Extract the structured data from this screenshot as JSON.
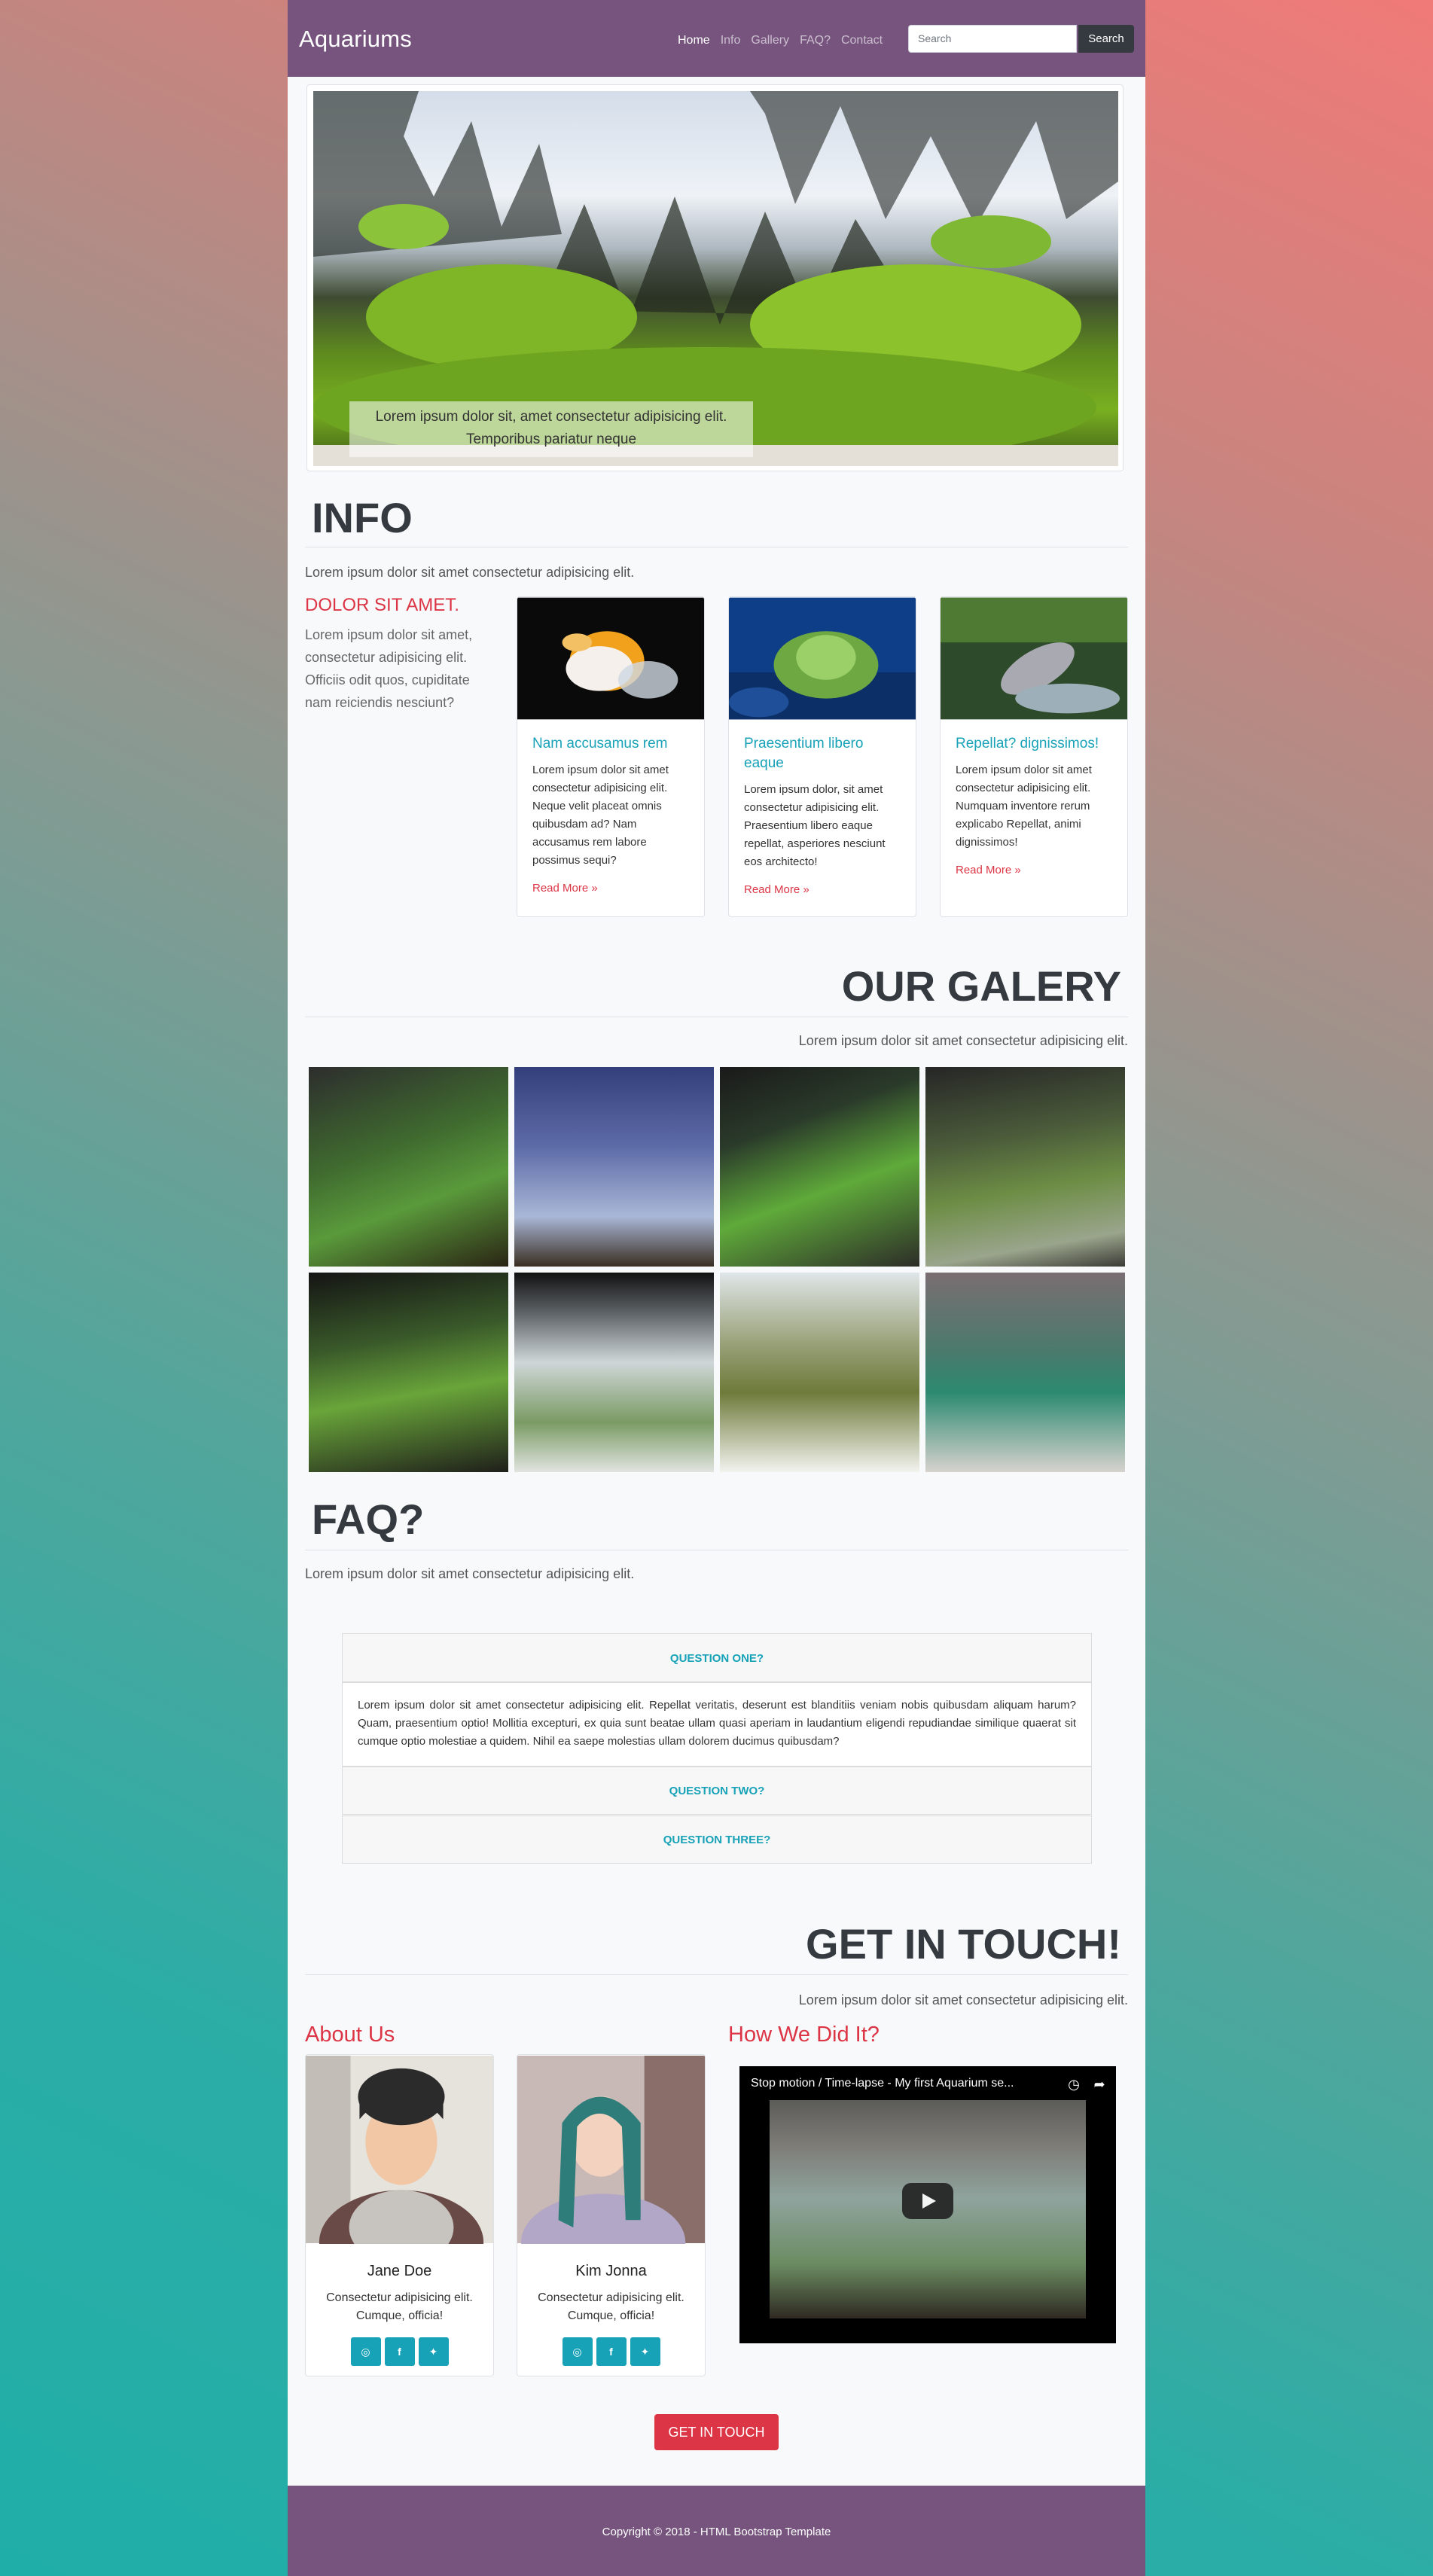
{
  "navbar": {
    "brand": "Aquariums",
    "links": [
      "Home",
      "Info",
      "Gallery",
      "FAQ?",
      "Contact"
    ],
    "search_placeholder": "Search",
    "search_button": "Search"
  },
  "hero": {
    "caption_line1": "Lorem ipsum dolor sit, amet consectetur adipisicing elit.",
    "caption_line2": "Temporibus pariatur neque"
  },
  "info": {
    "title": "INFO",
    "lead": "Lorem ipsum dolor sit amet consectetur adipisicing elit.",
    "side_heading": "DOLOR SIT AMET.",
    "side_text": "Lorem ipsum dolor sit amet, consectetur adipisicing elit. Officiis odit quos, cupiditate nam reiciendis nesciunt?",
    "cards": [
      {
        "title": "Nam accusamus rem",
        "text": "Lorem ipsum dolor sit amet consectetur adipisicing elit. Neque velit placeat omnis quibusdam ad? Nam accusamus rem labore possimus sequi?",
        "link": "Read More »"
      },
      {
        "title": "Praesentium libero eaque",
        "text": "Lorem ipsum dolor, sit amet consectetur adipisicing elit. Praesentium libero eaque repellat, asperiores nesciunt eos architecto!",
        "link": "Read More »"
      },
      {
        "title": "Repellat? dignissimos!",
        "text": "Lorem ipsum dolor sit amet consectetur adipisicing elit. Numquam inventore rerum explicabo Repellat, animi dignissimos!",
        "link": "Read More »"
      }
    ]
  },
  "gallery": {
    "title": "OUR GALERY",
    "lead": "Lorem ipsum dolor sit amet consectetur adipisicing elit."
  },
  "faq": {
    "title": "FAQ?",
    "lead": "Lorem ipsum dolor sit amet consectetur adipisicing elit.",
    "q1": "QUESTION ONE?",
    "a1": "Lorem ipsum dolor sit amet consectetur adipisicing elit. Repellat veritatis, deserunt est blanditiis veniam nobis quibusdam aliquam harum? Quam, praesentium optio! Mollitia excepturi, ex quia sunt beatae ullam quasi aperiam in laudantium eligendi repudiandae similique quaerat sit cumque optio molestiae a quidem. Nihil ea saepe molestias ullam dolorem ducimus quibusdam?",
    "q2": "QUESTION TWO?",
    "q3": "QUESTION THREE?"
  },
  "contact": {
    "title": "GET IN TOUCH!",
    "lead": "Lorem ipsum dolor sit amet consectetur adipisicing elit.",
    "about_heading": "About Us",
    "how_heading": "How We Did It?",
    "people": [
      {
        "name": "Jane Doe",
        "desc": "Consectetur adipisicing elit. Cumque, officia!"
      },
      {
        "name": "Kim Jonna",
        "desc": "Consectetur adipisicing elit. Cumque, officia!"
      }
    ],
    "video_title": "Stop motion / Time-lapse - My first Aquarium se...",
    "cta": "GET IN TOUCH"
  },
  "footer": {
    "copyright": "Copyright © 2018 - HTML Bootstrap Template"
  },
  "colors": {
    "navbar": "#76547e",
    "accent_red": "#dc3545",
    "accent_teal": "#17a2b8",
    "dark_button": "#343a40"
  },
  "icons": [
    "instagram-icon",
    "facebook-icon",
    "twitter-icon",
    "clock-icon",
    "share-icon",
    "play-icon"
  ]
}
